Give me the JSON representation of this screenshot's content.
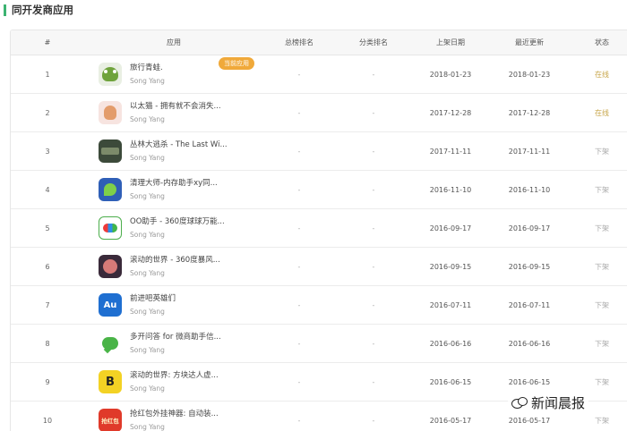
{
  "section_title": "同开发商应用",
  "table": {
    "headers": {
      "num": "#",
      "app": "应用",
      "total_rank": "总榜排名",
      "category_rank": "分类排名",
      "release_date": "上架日期",
      "latest_update": "最近更新",
      "status": "状态"
    },
    "rows": [
      {
        "num": "1",
        "name": "旅行青蛙.",
        "developer": "Song Yang",
        "badge": "当前应用",
        "total_rank": "-",
        "category_rank": "-",
        "release_date": "2018-01-23",
        "latest_update": "2018-01-23",
        "status": "在线",
        "icon": "frog-icon"
      },
      {
        "num": "2",
        "name": "以太猫 - 拥有就不会消失...",
        "developer": "Song Yang",
        "badge": "",
        "total_rank": "-",
        "category_rank": "-",
        "release_date": "2017-12-28",
        "latest_update": "2017-12-28",
        "status": "在线",
        "icon": "cat-icon"
      },
      {
        "num": "3",
        "name": "丛林大逃杀 - The Last Wi...",
        "developer": "Song Yang",
        "badge": "",
        "total_rank": "-",
        "category_rank": "-",
        "release_date": "2017-11-11",
        "latest_update": "2017-11-11",
        "status": "下架",
        "icon": "jungle-icon"
      },
      {
        "num": "4",
        "name": "清理大师-内存助手xy同...",
        "developer": "Song Yang",
        "badge": "",
        "total_rank": "-",
        "category_rank": "-",
        "release_date": "2016-11-10",
        "latest_update": "2016-11-10",
        "status": "下架",
        "icon": "cleaner-icon"
      },
      {
        "num": "5",
        "name": "OO助手 - 360度球球万能...",
        "developer": "Song Yang",
        "badge": "",
        "total_rank": "-",
        "category_rank": "-",
        "release_date": "2016-09-17",
        "latest_update": "2016-09-17",
        "status": "下架",
        "icon": "oo-icon"
      },
      {
        "num": "6",
        "name": "滚动的世界 - 360度暴风...",
        "developer": "Song Yang",
        "badge": "",
        "total_rank": "-",
        "category_rank": "-",
        "release_date": "2016-09-15",
        "latest_update": "2016-09-15",
        "status": "下架",
        "icon": "rolling-icon"
      },
      {
        "num": "7",
        "name": "前进吧英雄们",
        "developer": "Song Yang",
        "badge": "",
        "total_rank": "-",
        "category_rank": "-",
        "release_date": "2016-07-11",
        "latest_update": "2016-07-11",
        "status": "下架",
        "icon": "au-icon"
      },
      {
        "num": "8",
        "name": "多开问答 for 微商助手信...",
        "developer": "Song Yang",
        "badge": "",
        "total_rank": "-",
        "category_rank": "-",
        "release_date": "2016-06-16",
        "latest_update": "2016-06-16",
        "status": "下架",
        "icon": "chat-icon"
      },
      {
        "num": "9",
        "name": "滚动的世界: 方块达人虚...",
        "developer": "Song Yang",
        "badge": "",
        "total_rank": "-",
        "category_rank": "-",
        "release_date": "2016-06-15",
        "latest_update": "2016-06-15",
        "status": "下架",
        "icon": "b-icon"
      },
      {
        "num": "10",
        "name": "抢红包外挂神器: 自动装...",
        "developer": "Song Yang",
        "badge": "",
        "total_rank": "-",
        "category_rank": "-",
        "release_date": "2016-05-17",
        "latest_update": "2016-05-17",
        "status": "下架",
        "icon": "redpacket-icon"
      }
    ]
  },
  "icon_text": {
    "au": "Au",
    "b": "B",
    "redpacket": "抢红包"
  },
  "watermark": "新闻晨报",
  "colors": {
    "accent_green": "#3cb371",
    "badge_orange": "#f0a93a",
    "status_online": "#c8a64a",
    "status_offline": "#aaaaaa"
  }
}
